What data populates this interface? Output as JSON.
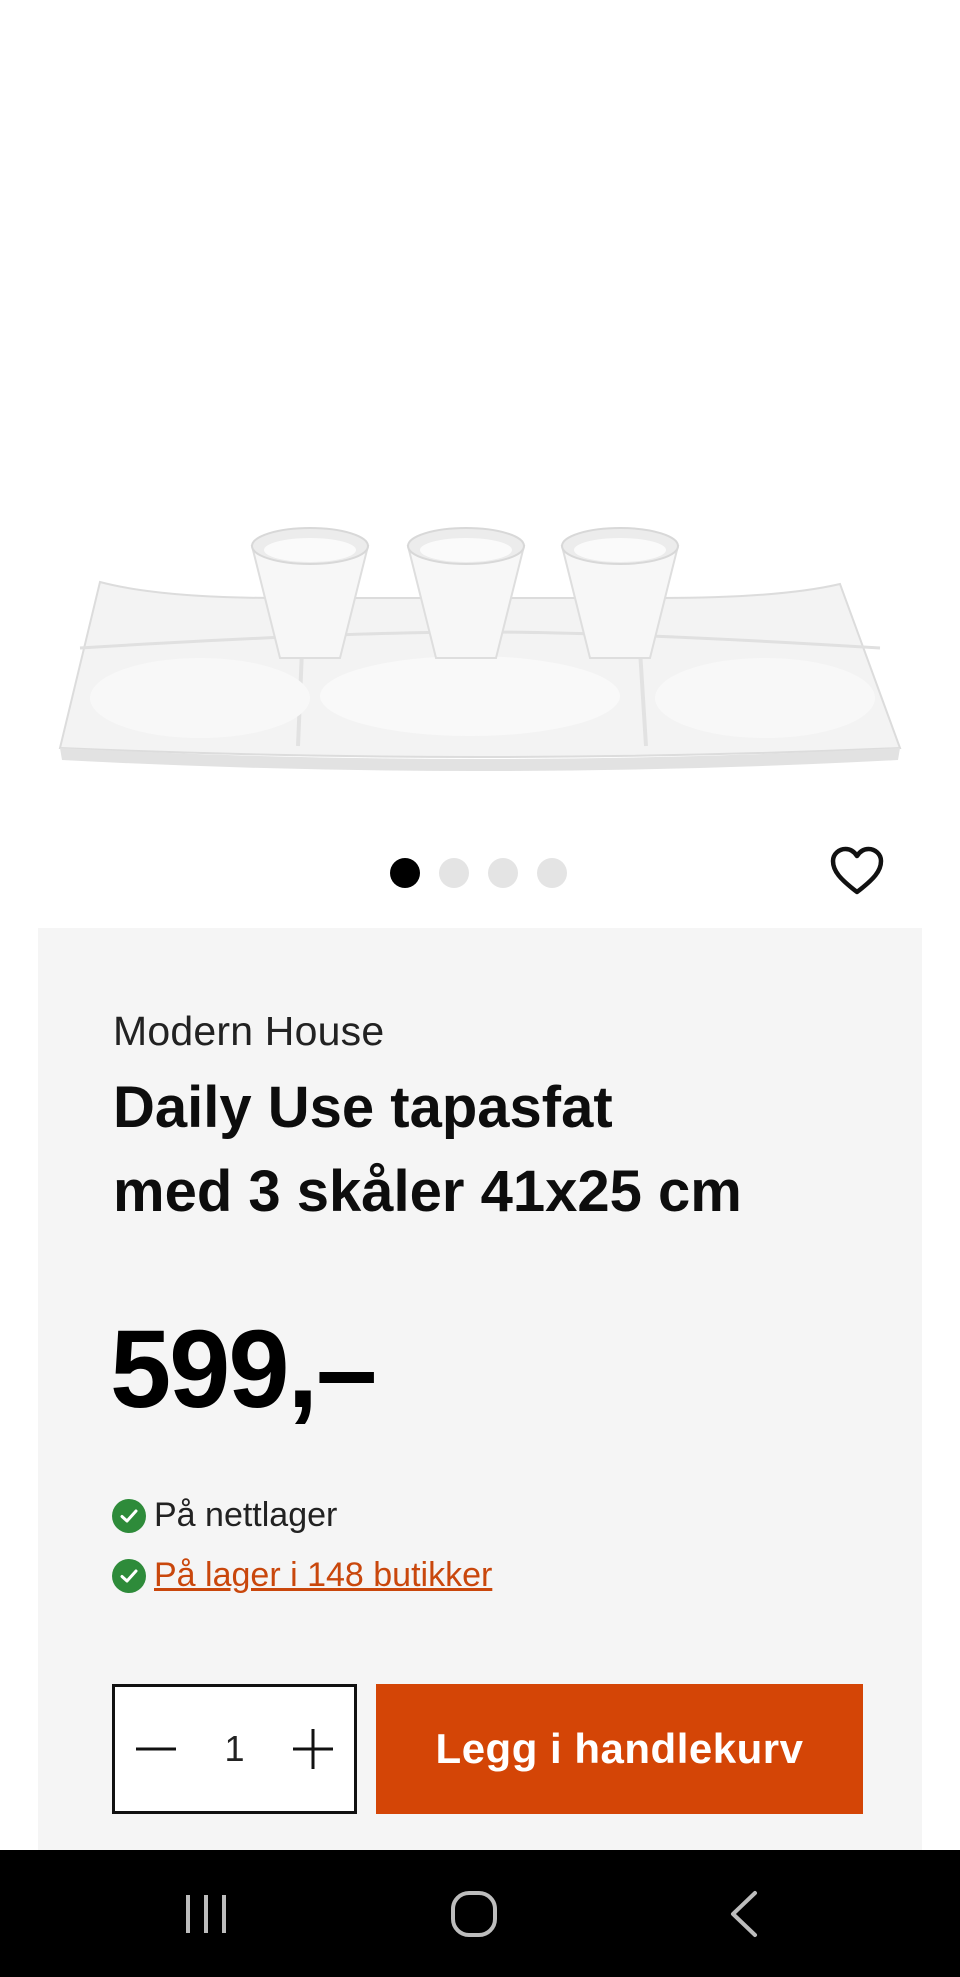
{
  "gallery": {
    "image_alt": "Daily Use tapasfat med 3 skåler",
    "page_count": 4,
    "active_index": 0
  },
  "product": {
    "brand": "Modern House",
    "title_line1": "Daily Use tapasfat",
    "title_line2": "med 3 skåler 41x25 cm",
    "price": "599,–"
  },
  "availability": {
    "online": "På nettlager",
    "stores": " På lager i 148 butikker"
  },
  "purchase": {
    "quantity": "1",
    "add_to_cart_label": "Legg i handlekurv"
  },
  "colors": {
    "accent": "#d44506",
    "link": "#c9470c",
    "in_stock": "#2e8b3a",
    "card_background": "#f5f5f5"
  },
  "icons": {
    "favorite": "heart-outline-icon",
    "stock": "check-circle-icon",
    "decrease": "minus-icon",
    "increase": "plus-icon",
    "recents": "recent-apps-icon",
    "home": "home-icon",
    "back": "back-icon"
  }
}
